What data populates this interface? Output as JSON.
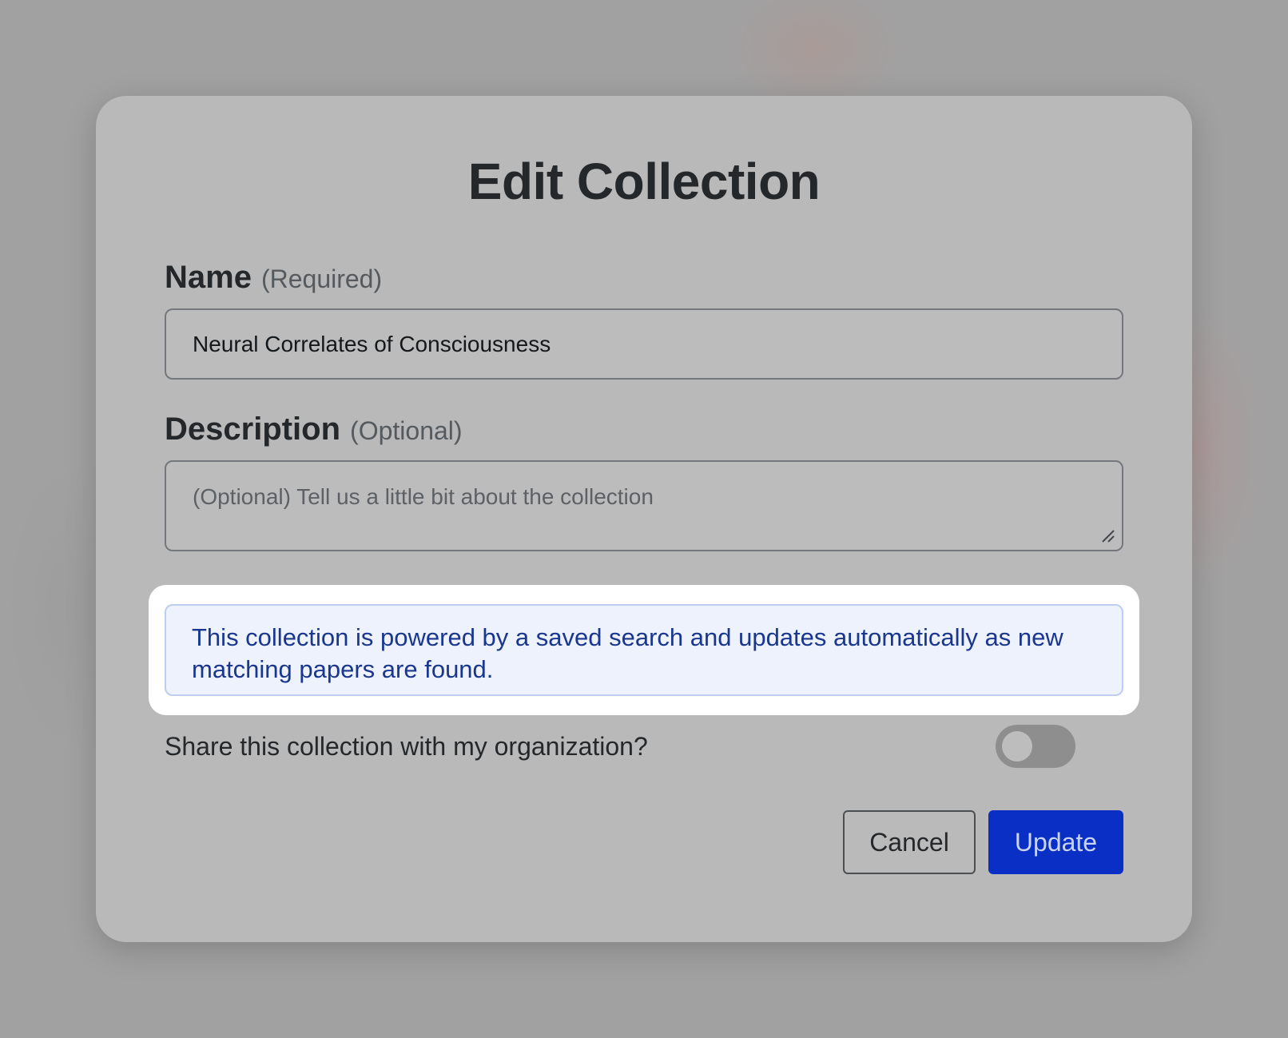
{
  "dialog": {
    "title": "Edit Collection"
  },
  "name_field": {
    "label": "Name",
    "hint": "(Required)",
    "value": "Neural Correlates of Consciousness"
  },
  "description_field": {
    "label": "Description",
    "hint": "(Optional)",
    "placeholder": "(Optional) Tell us a little bit about the collection",
    "value": ""
  },
  "info_banner": {
    "text": "This collection is powered by a saved search and updates automatically as new matching papers are found."
  },
  "share": {
    "label": "Share this collection with my organization?",
    "enabled": false
  },
  "actions": {
    "cancel_label": "Cancel",
    "update_label": "Update"
  },
  "colors": {
    "primary": "#0a2fc4",
    "info_text": "#1a3790",
    "info_background": "#edf2fd"
  }
}
